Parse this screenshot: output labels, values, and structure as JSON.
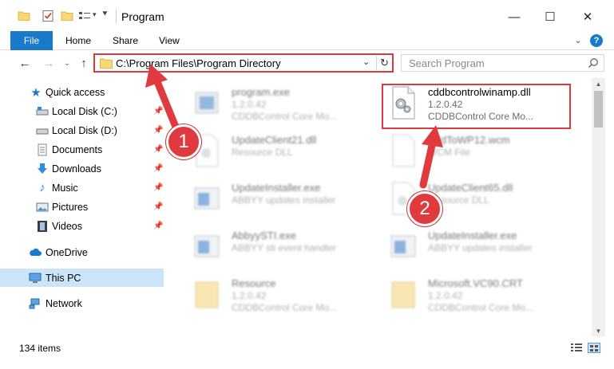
{
  "window": {
    "title": "Program",
    "minimize_glyph": "—",
    "maximize_glyph": "☐",
    "close_glyph": "✕"
  },
  "ribbon": {
    "file": "File",
    "home": "Home",
    "share": "Share",
    "view": "View",
    "help": "?"
  },
  "address": {
    "path": "C:\\Program Files\\Program Directory",
    "search_placeholder": "Search Program"
  },
  "nav": {
    "quick_access": "Quick access",
    "local_c": "Local Disk (C:)",
    "local_d": "Local Disk (D:)",
    "documents": "Documents",
    "downloads": "Downloads",
    "music": "Music",
    "pictures": "Pictures",
    "videos": "Videos",
    "onedrive": "OneDrive",
    "this_pc": "This PC",
    "network": "Network"
  },
  "files": {
    "f0": {
      "name": "program.exe",
      "line1": "1.2.0.42",
      "line2": "CDDBControl Core Mo..."
    },
    "f1": {
      "name": "cddbcontrolwinamp.dll",
      "line1": "1.2.0.42",
      "line2": "CDDBControl Core Mo..."
    },
    "f2": {
      "name": "UpdateClient21.dll",
      "line1": "Resource DLL"
    },
    "f3": {
      "name": "AddToWP12.wcm",
      "line1": "WCM File"
    },
    "f4": {
      "name": "UpdateInstaller.exe",
      "line1": "ABBYY updates installer"
    },
    "f5": {
      "name": "UpdateClient65.dll",
      "line1": "Resource DLL"
    },
    "f6": {
      "name": "AbbyySTI.exe",
      "line1": "ABBYY sti event handler"
    },
    "f7": {
      "name": "UpdateInstaller.exe",
      "line1": "ABBYY updates installer"
    },
    "f8": {
      "name": "Resource",
      "line1": "1.2.0.42",
      "line2": "CDDBControl Core Mo..."
    },
    "f9": {
      "name": "Microsoft.VC90.CRT",
      "line1": "1.2.0.42",
      "line2": "CDDBControl Core Mo..."
    }
  },
  "status": {
    "item_count": "134 items"
  },
  "annotations": {
    "step1": "1",
    "step2": "2"
  },
  "colors": {
    "accent": "#1979ca",
    "highlight": "#e0393e",
    "selection": "#cce4f7"
  }
}
